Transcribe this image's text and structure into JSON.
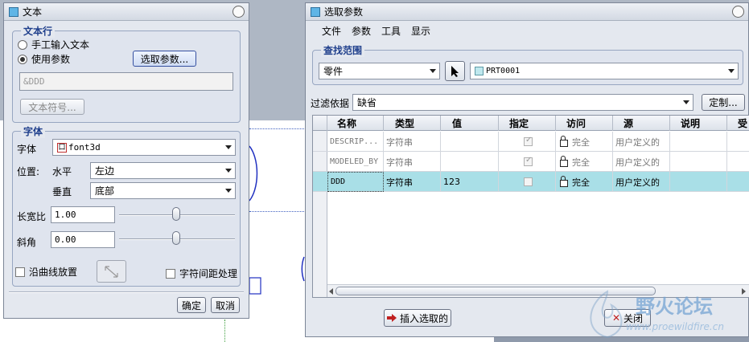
{
  "text_dialog": {
    "title": "文本",
    "text_line_group": "文本行",
    "radio_manual": "手工输入文本",
    "radio_param": "使用参数",
    "select_param_button": "选取参数...",
    "text_value": "&DDD",
    "text_symbol_button": "文本符号...",
    "font_group": "字体",
    "font_label": "字体",
    "font_value": "font3d",
    "position_label": "位置:",
    "horizontal_label": "水平",
    "horizontal_value": "左边",
    "vertical_label": "垂直",
    "vertical_value": "底部",
    "aspect_label": "长宽比",
    "aspect_value": "1.00",
    "slant_label": "斜角",
    "slant_value": "0.00",
    "place_on_curve": "沿曲线放置",
    "char_spacing": "字符间距处理",
    "ok_button": "确定",
    "cancel_button": "取消"
  },
  "param_dialog": {
    "title": "选取参数",
    "menu": [
      "文件",
      "参数",
      "工具",
      "显示"
    ],
    "search_group": "查找范围",
    "scope_value": "零件",
    "model_value": "PRT0001",
    "filter_label": "过滤依据",
    "filter_value": "缺省",
    "customize_button": "定制...",
    "columns": [
      "名称",
      "类型",
      "值",
      "指定",
      "访问",
      "源",
      "说明",
      "受"
    ],
    "rows": [
      {
        "name": "DESCRIP...",
        "type": "字符串",
        "value": "",
        "designated": true,
        "access": "完全",
        "source": "用户定义的",
        "desc": ""
      },
      {
        "name": "MODELED_BY",
        "type": "字符串",
        "value": "",
        "designated": true,
        "access": "完全",
        "source": "用户定义的",
        "desc": ""
      },
      {
        "name": "DDD",
        "type": "字符串",
        "value": "123",
        "designated": false,
        "access": "完全",
        "source": "用户定义的",
        "desc": ""
      }
    ],
    "insert_button": "插入选取的",
    "close_button": "关闭"
  },
  "watermark": {
    "title": "野火论坛",
    "url": "www.proewildfire.cn"
  },
  "colors": {
    "selected_row": "#a9dfe7",
    "group_label": "#1f3f8c"
  }
}
